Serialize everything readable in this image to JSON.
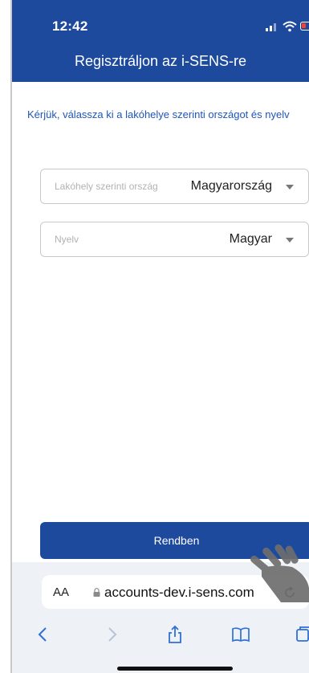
{
  "status_bar": {
    "time": "12:42"
  },
  "header": {
    "title": "Regisztráljon az i-SENS-re"
  },
  "instruction": "Kérjük, válassza ki a lakóhelye szerinti országot és nyelv",
  "fields": [
    {
      "label": "Lakóhely szerinti ország",
      "value": "Magyarország"
    },
    {
      "label": "Nyelv",
      "value": "Magyar"
    }
  ],
  "ok_button": {
    "label": "Rendben"
  },
  "browser": {
    "text_size_label": "AA",
    "url": "accounts-dev.i-sens.com"
  },
  "colors": {
    "primary": "#1e4a9e",
    "link_text": "#1f56b8",
    "battery_low": "#ff3b30",
    "browser_icon": "#2f6fd8"
  },
  "icons": [
    "signal-icon",
    "wifi-icon",
    "battery-icon",
    "dropdown-caret-icon",
    "lock-icon",
    "reload-icon",
    "back-icon",
    "forward-icon",
    "share-icon",
    "bookmarks-icon",
    "tabs-icon",
    "hand-pointer-icon"
  ]
}
